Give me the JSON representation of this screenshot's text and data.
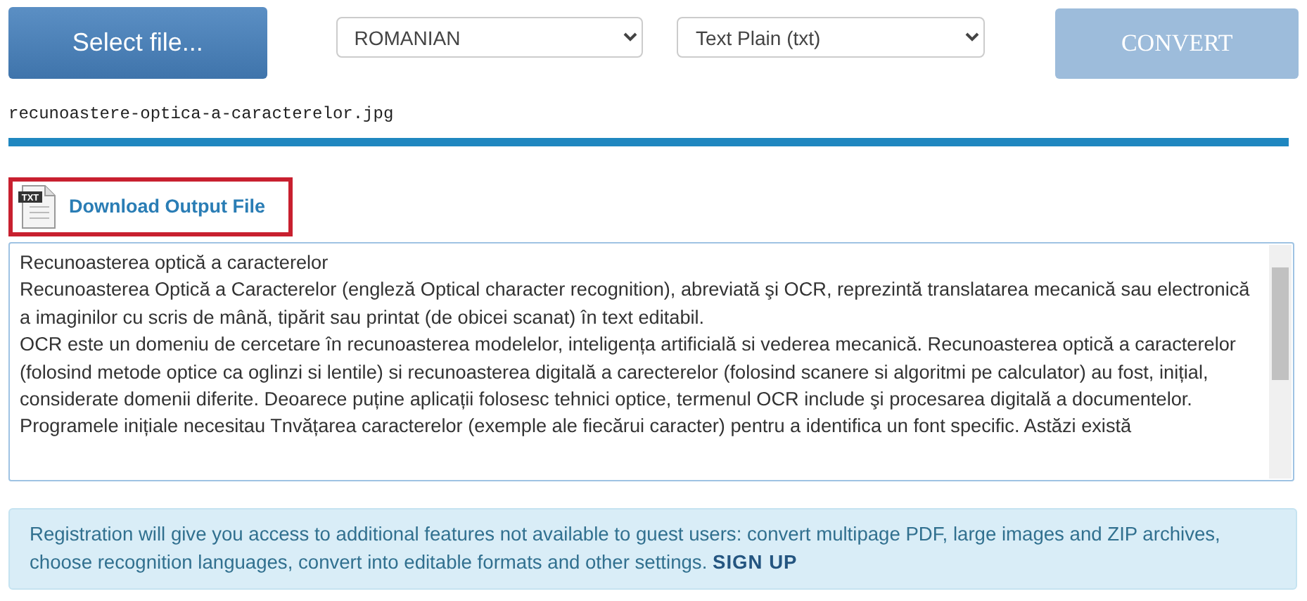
{
  "toolbar": {
    "select_file": "Select file...",
    "language": "ROMANIAN",
    "format": "Text Plain (txt)",
    "convert": {
      "label": "CONVERT",
      "disabled": true
    }
  },
  "file_name": "recunoastere-optica-a-caracterelor.jpg",
  "progress": {
    "level": 1.0
  },
  "download": {
    "icon_text": "TXT",
    "label": "Download Output File"
  },
  "output_text": [
    "Recunoasterea optică a caracterelor",
    "Recunoasterea Optică a Caracterelor (engleză Optical character recognition), abreviată şi OCR, reprezintă translatarea mecanică sau electronică a imaginilor cu scris de mână, tipărit sau printat (de obicei scanat) în text editabil.",
    "OCR este un domeniu de cercetare în recunoasterea modelelor, inteligența artificială si vederea mecanică. Recunoasterea optică a caracterelor (folosind metode optice ca oglinzi si lentile) si recunoasterea digitală a carecterelor (folosind scanere si algoritmi pe calculator) au fost, inițial, considerate domenii diferite. Deoarece puține aplicații folosesc tehnici optice, termenul OCR include şi procesarea digitală a documentelor.",
    "Programele inițiale necesitau Tnvățarea caracterelor (exemple ale fiecărui caracter) pentru a identifica un font specific. Astăzi există"
  ],
  "notice": {
    "text": "Registration will give you access to additional features not available to guest users: convert multipage PDF, large images and ZIP archives, choose recognition languages, convert into editable formats and other settings.",
    "link": "SIGN UP"
  }
}
